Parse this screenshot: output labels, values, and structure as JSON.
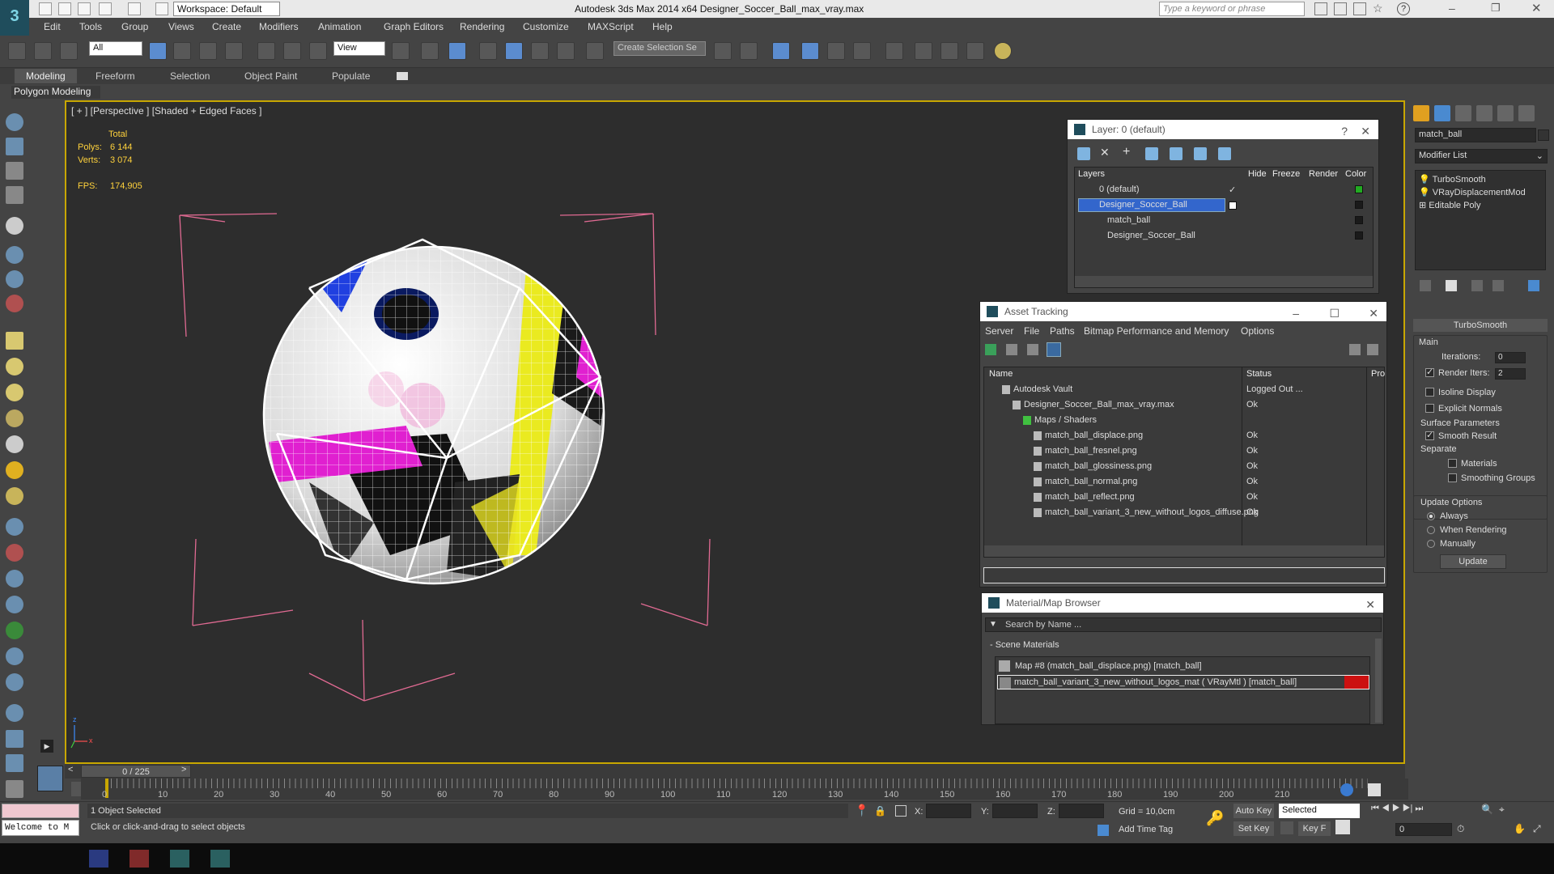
{
  "app": {
    "title": "Autodesk 3ds Max  2014 x64     Designer_Soccer_Ball_max_vray.max",
    "workspace": "Workspace: Default",
    "search_placeholder": "Type a keyword or phrase"
  },
  "menu": [
    "Edit",
    "Tools",
    "Group",
    "Views",
    "Create",
    "Modifiers",
    "Animation",
    "Graph Editors",
    "Rendering",
    "Customize",
    "MAXScript",
    "Help"
  ],
  "toolbar": {
    "filter_select": "All",
    "refcoord_select": "View",
    "selection_set": "Create Selection Se"
  },
  "ribbon": {
    "tabs": [
      "Modeling",
      "Freeform",
      "Selection",
      "Object Paint",
      "Populate"
    ],
    "active_tab": "Modeling",
    "panel_label": "Polygon Modeling"
  },
  "viewport": {
    "label": "[ + ] [Perspective ] [Shaded + Edged Faces ]",
    "stats": {
      "total_label": "Total",
      "polys_label": "Polys:",
      "polys": "6 144",
      "verts_label": "Verts:",
      "verts": "3 074",
      "fps_label": "FPS:",
      "fps": "174,905"
    },
    "axis_labels": {
      "z": "z",
      "x": "x"
    }
  },
  "layer_window": {
    "title": "Layer: 0 (default)",
    "columns": [
      "Layers",
      "Hide",
      "Freeze",
      "Render",
      "Color"
    ],
    "rows": [
      {
        "name": "0 (default)",
        "indent": 1,
        "selected": false,
        "color": "#22aa22"
      },
      {
        "name": "Designer_Soccer_Ball",
        "indent": 1,
        "selected": true,
        "color": "#1a1a1a"
      },
      {
        "name": "match_ball",
        "indent": 2,
        "selected": false,
        "color": "#1a1a1a"
      },
      {
        "name": "Designer_Soccer_Ball",
        "indent": 2,
        "selected": false,
        "color": "#1a1a1a"
      }
    ]
  },
  "asset_window": {
    "title": "Asset Tracking",
    "menu": [
      "Server",
      "File",
      "Paths",
      "Bitmap Performance and Memory",
      "Options"
    ],
    "columns": [
      "Name",
      "Status",
      "Pro"
    ],
    "rows": [
      {
        "name": "Autodesk Vault",
        "status": "Logged Out ...",
        "indent": 0
      },
      {
        "name": "Designer_Soccer_Ball_max_vray.max",
        "status": "Ok",
        "indent": 1
      },
      {
        "name": "Maps / Shaders",
        "status": "",
        "indent": 2
      },
      {
        "name": "match_ball_displace.png",
        "status": "Ok",
        "indent": 3
      },
      {
        "name": "match_ball_fresnel.png",
        "status": "Ok",
        "indent": 3
      },
      {
        "name": "match_ball_glossiness.png",
        "status": "Ok",
        "indent": 3
      },
      {
        "name": "match_ball_normal.png",
        "status": "Ok",
        "indent": 3
      },
      {
        "name": "match_ball_reflect.png",
        "status": "Ok",
        "indent": 3
      },
      {
        "name": "match_ball_variant_3_new_without_logos_diffuse.png",
        "status": "Ok",
        "indent": 3
      }
    ]
  },
  "material_window": {
    "title": "Material/Map Browser",
    "search_placeholder": "Search by Name ...",
    "group": "- Scene Materials",
    "items": [
      "Map #8 (match_ball_displace.png)  [match_ball]",
      "match_ball_variant_3_new_without_logos_mat  ( VRayMtl )  [match_ball]"
    ]
  },
  "command_panel": {
    "object_name": "match_ball",
    "modifier_list": "Modifier List",
    "stack": [
      "TurboSmooth",
      "VRayDisplacementMod",
      "Editable Poly"
    ],
    "rollout_title": "TurboSmooth",
    "main_label": "Main",
    "iterations_label": "Iterations:",
    "iterations": "0",
    "render_iters_label": "Render Iters:",
    "render_iters": "2",
    "isoline": "Isoline Display",
    "explicit_normals": "Explicit Normals",
    "surface_params": "Surface Parameters",
    "smooth_result": "Smooth Result",
    "separate": "Separate",
    "materials": "Materials",
    "smoothing_groups": "Smoothing Groups",
    "update_options": "Update Options",
    "always": "Always",
    "when_rendering": "When Rendering",
    "manually": "Manually",
    "update_button": "Update"
  },
  "timeline": {
    "frame": "0 / 225",
    "ticks": [
      "0",
      "10",
      "20",
      "30",
      "40",
      "50",
      "60",
      "70",
      "80",
      "90",
      "100",
      "110",
      "120",
      "130",
      "140",
      "150",
      "160",
      "170",
      "180",
      "190",
      "200",
      "210"
    ]
  },
  "status": {
    "welcome": "Welcome to M",
    "selected": "1 Object Selected",
    "prompt": "Click or click-and-drag to select objects",
    "x_label": "X:",
    "y_label": "Y:",
    "z_label": "Z:",
    "grid": "Grid = 10,0cm",
    "add_time_tag": "Add Time Tag",
    "auto_key": "Auto Key",
    "set_key": "Set Key",
    "key_filter": "Key F",
    "selected_select": "Selected",
    "frame_field": "0"
  }
}
